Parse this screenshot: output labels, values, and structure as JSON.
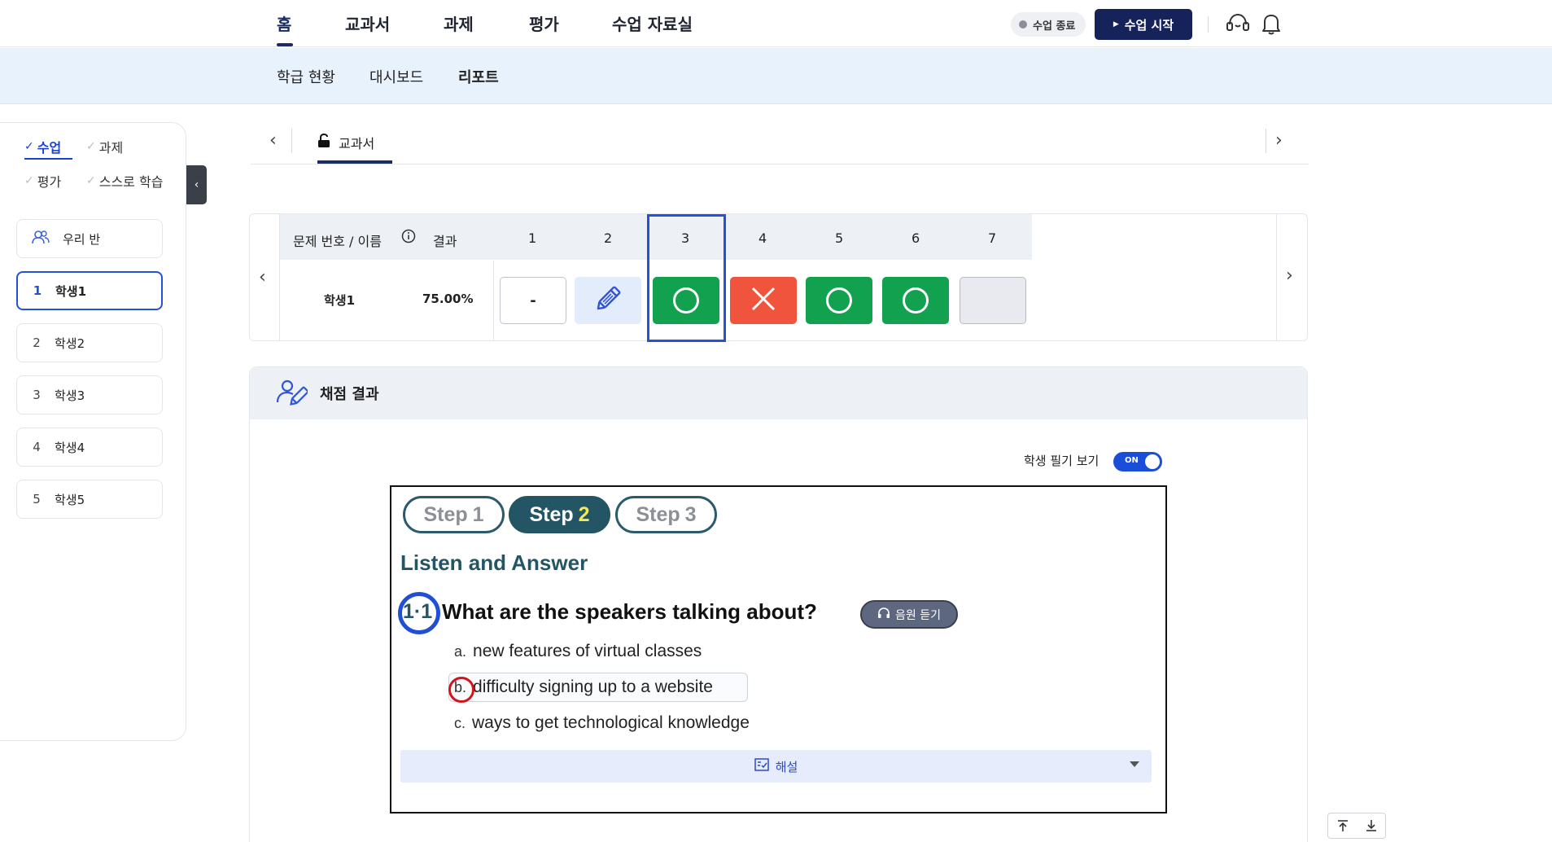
{
  "topnav": {
    "items": [
      "홈",
      "교과서",
      "과제",
      "평가",
      "수업 자료실"
    ],
    "status": "수업 종료",
    "start_label": "수업 시작",
    "icons": [
      "support-headset-icon",
      "bell-icon"
    ]
  },
  "subnav": {
    "items": [
      "학급 현황",
      "대시보드",
      "리포트"
    ],
    "active": "리포트"
  },
  "sidebar": {
    "filters": [
      "수업",
      "과제",
      "평가",
      "스스로 학습"
    ],
    "active_filter": "수업",
    "class_label": "우리 반",
    "students": [
      {
        "num": "1",
        "name": "학생1"
      },
      {
        "num": "2",
        "name": "학생2"
      },
      {
        "num": "3",
        "name": "학생3"
      },
      {
        "num": "4",
        "name": "학생4"
      },
      {
        "num": "5",
        "name": "학생5"
      }
    ],
    "selected_student": "1"
  },
  "tabs": {
    "items": [
      "교과서"
    ],
    "active": "교과서"
  },
  "result_table": {
    "header_name": "문제 번호 / 이름",
    "header_result": "결과",
    "columns": [
      "1",
      "2",
      "3",
      "4",
      "5",
      "6",
      "7"
    ],
    "student": "학생1",
    "score": "75.00%",
    "cells": [
      {
        "status": "none",
        "text": "-"
      },
      {
        "status": "pending",
        "icon": "pencil-icon"
      },
      {
        "status": "correct",
        "icon": "circle-o-icon"
      },
      {
        "status": "wrong",
        "icon": "x-icon"
      },
      {
        "status": "correct",
        "icon": "circle-o-icon"
      },
      {
        "status": "correct",
        "icon": "circle-o-icon"
      },
      {
        "status": "empty"
      }
    ],
    "selected_column": "3",
    "colors": {
      "correct": "#12a14f",
      "wrong": "#f0543d",
      "pending": "#e3ecfb",
      "empty": "#e8eaf0"
    }
  },
  "grading": {
    "title": "채점 결과",
    "toggle_label": "학생 필기 보기",
    "toggle_state": "ON",
    "content": {
      "steps": [
        {
          "word": "Step",
          "num": "1"
        },
        {
          "word": "Step",
          "num": "2"
        },
        {
          "word": "Step",
          "num": "3"
        }
      ],
      "active_step": "2",
      "section_title": "Listen and Answer",
      "qnum": "1·1",
      "question": "What are the speakers talking about?",
      "audio_label": "음원 듣기",
      "choices": [
        {
          "letter": "a.",
          "text": "new features of virtual classes"
        },
        {
          "letter": "b.",
          "text": "difficulty signing up to a website"
        },
        {
          "letter": "c.",
          "text": "ways to get technological knowledge"
        }
      ],
      "selected_choice": "b.",
      "explain_label": "해설"
    }
  }
}
